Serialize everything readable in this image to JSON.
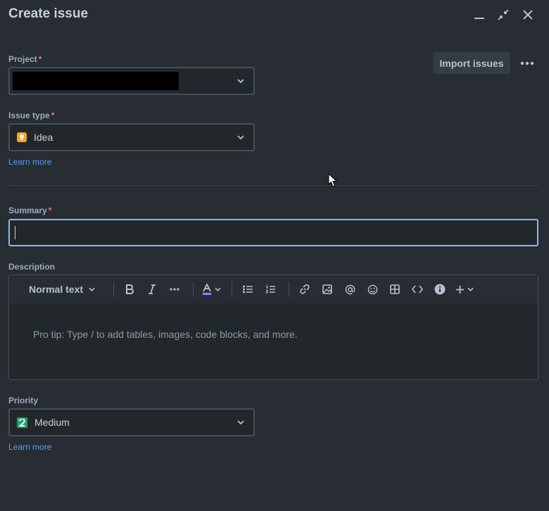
{
  "dialog": {
    "title": "Create issue"
  },
  "window_controls": {
    "minimize": "minimize-icon",
    "collapse": "collapse-icon",
    "close": "close-icon"
  },
  "header_actions": {
    "import_label": "Import issues",
    "more": "more-horizontal-icon"
  },
  "fields": {
    "project": {
      "label": "Project",
      "required_mark": "*",
      "value_redacted": true
    },
    "issue_type": {
      "label": "Issue type",
      "required_mark": "*",
      "value": "Idea",
      "icon": "lightbulb-icon",
      "icon_color": "#f5a623",
      "learn_more": "Learn more"
    },
    "summary": {
      "label": "Summary",
      "required_mark": "*",
      "value": ""
    },
    "description": {
      "label": "Description",
      "toolbar": {
        "text_style": "Normal text",
        "buttons": [
          "bold-icon",
          "italic-icon",
          "more-formatting-icon",
          "text-color-icon",
          "bullet-list-icon",
          "numbered-list-icon",
          "link-icon",
          "image-icon",
          "mention-icon",
          "emoji-icon",
          "table-icon",
          "code-icon",
          "info-icon",
          "plus-icon"
        ]
      },
      "placeholder": "Pro tip: Type / to add tables, images, code blocks, and more."
    },
    "priority": {
      "label": "Priority",
      "value": "Medium",
      "icon": "priority-medium-icon",
      "icon_color": "#22a06b",
      "learn_more": "Learn more"
    }
  },
  "colors": {
    "background": "#282c33",
    "accent_focus": "#85b8ff",
    "link": "#579dff",
    "required": "#f87168"
  }
}
